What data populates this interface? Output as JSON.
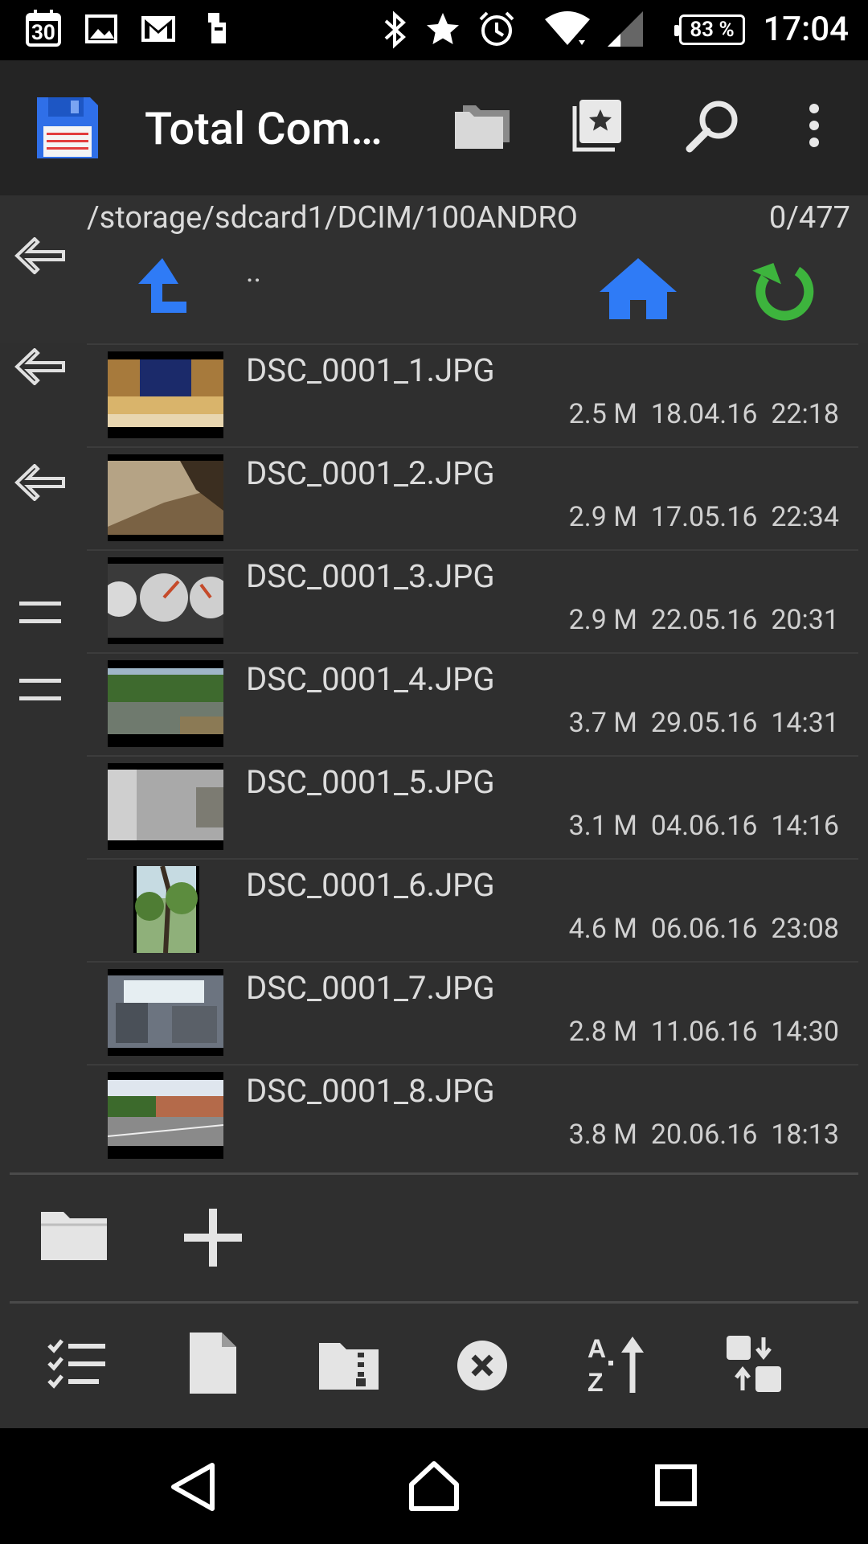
{
  "status_bar": {
    "calendar_day": "30",
    "battery": "83 %",
    "time": "17:04",
    "icons": [
      "calendar-icon",
      "gallery-icon",
      "gmail-icon",
      "usb-debug-icon",
      "bluetooth-icon",
      "star-icon",
      "alarm-icon",
      "wifi-icon",
      "signal-icon",
      "battery-icon"
    ]
  },
  "appbar": {
    "title": "Total Com…",
    "actions": [
      "folders-icon",
      "bookmark-icon",
      "search-icon",
      "more-vert-icon"
    ]
  },
  "path": {
    "current": "/storage/sdcard1/DCIM/100ANDRO",
    "count": "0/477",
    "parent_label": ".."
  },
  "files": [
    {
      "name": "DSC_0001_1.JPG",
      "size": "2.5 M",
      "date": "18.04.16",
      "time": "22:18"
    },
    {
      "name": "DSC_0001_2.JPG",
      "size": "2.9 M",
      "date": "17.05.16",
      "time": "22:34"
    },
    {
      "name": "DSC_0001_3.JPG",
      "size": "2.9 M",
      "date": "22.05.16",
      "time": "20:31"
    },
    {
      "name": "DSC_0001_4.JPG",
      "size": "3.7 M",
      "date": "29.05.16",
      "time": "14:31"
    },
    {
      "name": "DSC_0001_5.JPG",
      "size": "3.1 M",
      "date": "04.06.16",
      "time": "14:16"
    },
    {
      "name": "DSC_0001_6.JPG",
      "size": "4.6 M",
      "date": "06.06.16",
      "time": "23:08"
    },
    {
      "name": "DSC_0001_7.JPG",
      "size": "2.8 M",
      "date": "11.06.16",
      "time": "14:30"
    },
    {
      "name": "DSC_0001_8.JPG",
      "size": "3.8 M",
      "date": "20.06.16",
      "time": "18:13"
    }
  ],
  "bottom_toolbar": [
    "select-icon",
    "new-file-icon",
    "zip-icon",
    "delete-icon",
    "sort-icon",
    "swap-panels-icon"
  ],
  "colors": {
    "accent_blue": "#2f7bf6",
    "refresh_green": "#3db43d",
    "bg": "#2f2f2f",
    "appbar": "#242424"
  }
}
